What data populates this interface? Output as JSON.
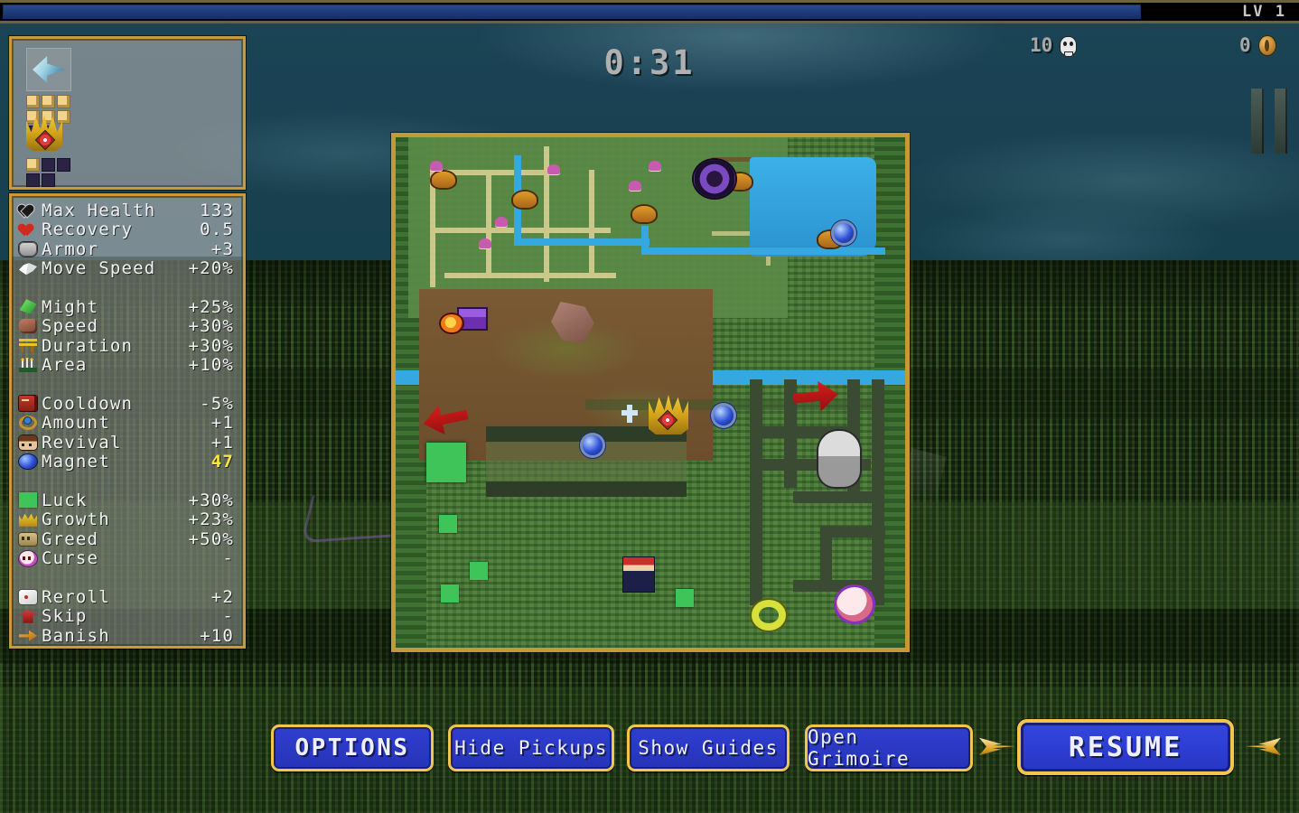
{
  "hud": {
    "level_label": "LV 1",
    "xp_percent": 88,
    "timer": "0:31",
    "kills": "10",
    "kills_icon": "skull-icon",
    "gold": "0",
    "gold_icon": "coin-icon",
    "pause_icon": "pause-icon"
  },
  "inventory": {
    "weapon_icon": "knife-weapon-icon",
    "weapon_pips": [
      "on",
      "on",
      "on",
      "on",
      "on",
      "on",
      "off",
      "off",
      "blank"
    ],
    "passive_icon": "crown-passive-icon",
    "passive_pips": [
      "on",
      "off",
      "off",
      "off",
      "off",
      "blank",
      "blank",
      "blank",
      "blank"
    ]
  },
  "stats": {
    "groups": [
      {
        "rows": [
          {
            "icon": "black-heart-icon",
            "icon_class": "i-blkheart",
            "label": "Max Health",
            "value": "133",
            "highlight": false
          },
          {
            "icon": "red-heart-icon",
            "icon_class": "i-redheart",
            "label": "Recovery",
            "value": "0.5",
            "highlight": false
          },
          {
            "icon": "armor-icon",
            "icon_class": "i-armor",
            "label": "Armor",
            "value": "+3",
            "highlight": false
          },
          {
            "icon": "wing-icon",
            "icon_class": "i-wing",
            "label": "Move Speed",
            "value": "+20%",
            "highlight": false
          }
        ]
      },
      {
        "rows": [
          {
            "icon": "leaf-icon",
            "icon_class": "i-leaf",
            "label": "Might",
            "value": "+25%",
            "highlight": false
          },
          {
            "icon": "glove-icon",
            "icon_class": "i-glove",
            "label": "Speed",
            "value": "+30%",
            "highlight": false
          },
          {
            "icon": "torii-gate-icon",
            "icon_class": "i-torii",
            "label": "Duration",
            "value": "+30%",
            "highlight": false
          },
          {
            "icon": "candles-icon",
            "icon_class": "i-candle",
            "label": "Area",
            "value": "+10%",
            "highlight": false
          }
        ]
      },
      {
        "rows": [
          {
            "icon": "book-icon",
            "icon_class": "i-book",
            "label": "Cooldown",
            "value": "-5%",
            "highlight": false
          },
          {
            "icon": "ring-icon",
            "icon_class": "i-ring",
            "label": "Amount",
            "value": "+1",
            "highlight": false
          },
          {
            "icon": "face-icon",
            "icon_class": "i-face",
            "label": "Revival",
            "value": "+1",
            "highlight": false
          },
          {
            "icon": "magnet-orb-icon",
            "icon_class": "i-magnet",
            "label": "Magnet",
            "value": "47",
            "highlight": true
          }
        ]
      },
      {
        "rows": [
          {
            "icon": "clover-icon",
            "icon_class": "i-clover",
            "label": "Luck",
            "value": "+30%",
            "highlight": false
          },
          {
            "icon": "growth-crown-icon",
            "icon_class": "i-growth",
            "label": "Growth",
            "value": "+23%",
            "highlight": false
          },
          {
            "icon": "greed-coin-icon",
            "icon_class": "i-greed",
            "label": "Greed",
            "value": "+50%",
            "highlight": false
          },
          {
            "icon": "curse-skull-icon",
            "icon_class": "i-curse",
            "label": "Curse",
            "value": "-",
            "highlight": false
          }
        ]
      },
      {
        "rows": [
          {
            "icon": "dice-icon",
            "icon_class": "i-dice",
            "label": "Reroll",
            "value": "+2",
            "highlight": false
          },
          {
            "icon": "skip-icon",
            "icon_class": "i-skip",
            "label": "Skip",
            "value": "-",
            "highlight": false
          },
          {
            "icon": "banish-icon",
            "icon_class": "i-banish",
            "label": "Banish",
            "value": "+10",
            "highlight": false
          }
        ]
      }
    ]
  },
  "buttons": {
    "options": "OPTIONS",
    "hide_pickups": "Hide Pickups",
    "show_guides": "Show Guides",
    "open_grimoire": "Open Grimoire",
    "resume": "RESUME"
  },
  "colors": {
    "frame_gold": "#c89a3c",
    "button_blue": "#2f3ed0",
    "button_border": "#f0c64e",
    "xp_blue": "#1d3a7a",
    "highlight_yellow": "#f7e93b",
    "text_light": "#f2f2f2"
  }
}
